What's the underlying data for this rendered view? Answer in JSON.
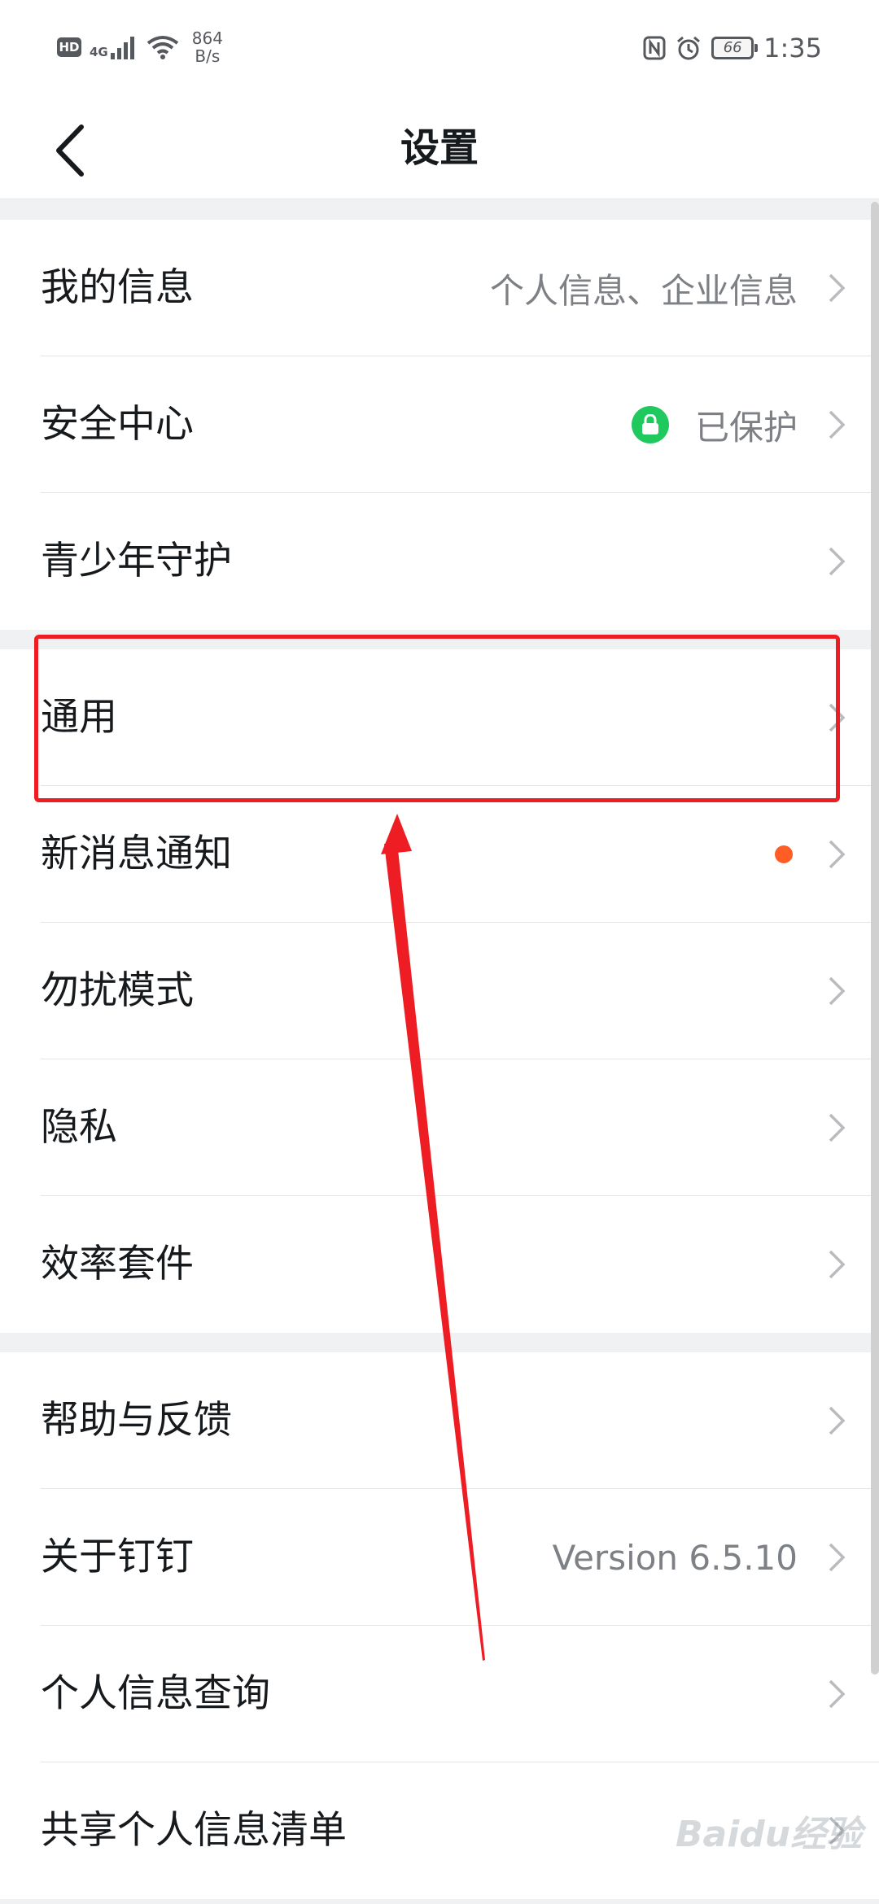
{
  "status_bar": {
    "hd_label": "HD",
    "network_label": "4G",
    "net_speed_value": "864",
    "net_speed_unit": "B/s",
    "battery_level": "66",
    "time": "1:35",
    "icons": [
      "signal-icon",
      "wifi-icon",
      "nfc-icon",
      "alarm-icon",
      "battery-icon"
    ]
  },
  "header": {
    "title": "设置",
    "back_icon": "back-arrow-icon"
  },
  "groups": [
    {
      "items": [
        {
          "label": "我的信息",
          "value": "个人信息、企业信息"
        },
        {
          "label": "安全中心",
          "value": "已保护",
          "status_icon": "lock-icon"
        },
        {
          "label": "青少年守护",
          "value": ""
        }
      ]
    },
    {
      "items": [
        {
          "label": "通用",
          "value": "",
          "highlighted": true
        },
        {
          "label": "新消息通知",
          "value": "",
          "badge": "dot"
        },
        {
          "label": "勿扰模式",
          "value": ""
        },
        {
          "label": "隐私",
          "value": ""
        },
        {
          "label": "效率套件",
          "value": ""
        }
      ]
    },
    {
      "items": [
        {
          "label": "帮助与反馈",
          "value": ""
        },
        {
          "label": "关于钉钉",
          "value": "Version 6.5.10"
        },
        {
          "label": "个人信息查询",
          "value": ""
        },
        {
          "label": "共享个人信息清单",
          "value": ""
        }
      ]
    }
  ],
  "colors": {
    "accent_green": "#1fc95e",
    "notification_dot": "#ff5c26",
    "annotation_red": "#ee1d24",
    "background": "#f0f1f3"
  },
  "watermark": "Baidu经验"
}
